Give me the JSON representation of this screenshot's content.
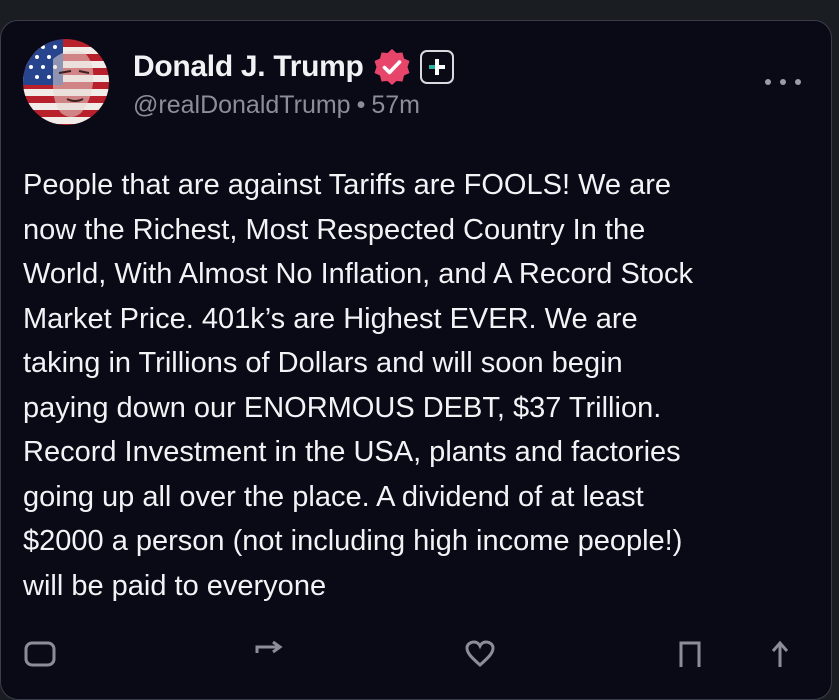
{
  "post": {
    "author_name": "Donald J. Trump",
    "handle": "@realDonaldTrump",
    "separator": "•",
    "time": "57m",
    "body": "People that are against Tariffs are FOOLS! We are\nnow the Richest, Most Respected Country In the\nWorld, With Almost No Inflation, and A Record Stock\nMarket Price. 401k’s are Highest EVER. We are\ntaking in Trillions of Dollars and will soon begin\npaying down our ENORMOUS DEBT, $37 Trillion.\nRecord Investment in the USA, plants and factories\ngoing up all over the place. A dividend of at least\n$2000 a person (not including high income people!)\nwill be paid to everyone"
  },
  "icons": {
    "verified": "verified-badge-icon",
    "plus": "plus-badge-icon",
    "more": "more-options-icon",
    "reply": "reply-icon",
    "repost": "repost-icon",
    "like": "like-icon",
    "bookmark": "bookmark-icon",
    "share": "share-icon"
  },
  "colors": {
    "background": "#0a0a17",
    "verified": "#e8456b",
    "text": "#f3f3f6",
    "muted": "#8b8d98"
  }
}
